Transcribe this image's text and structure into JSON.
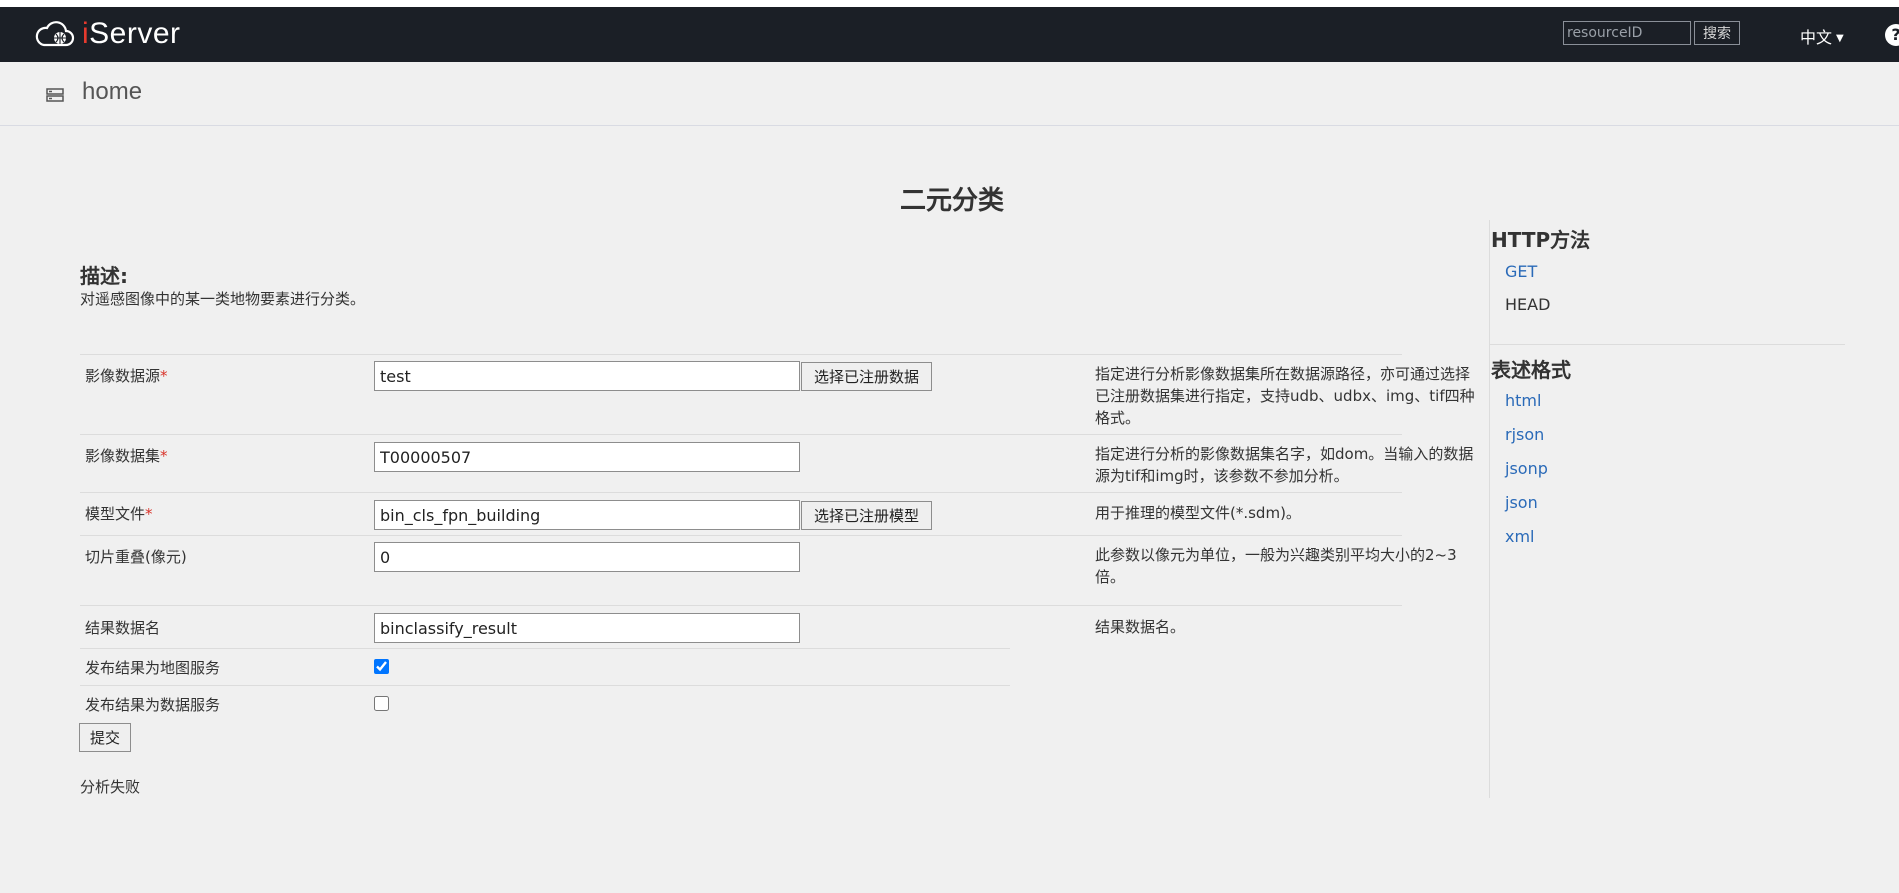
{
  "navbar": {
    "logo_prefix": "i",
    "logo_text": "Server",
    "search_placeholder": "resourceID",
    "search_button": "搜索",
    "language": "中文",
    "help": "?"
  },
  "breadcrumb": {
    "home": "home"
  },
  "page": {
    "title": "二元分类",
    "desc_heading": "描述:",
    "desc_text": "对遥感图像中的某一类地物要素进行分类。"
  },
  "form": {
    "image_datasource": {
      "label": "影像数据源",
      "required": "*",
      "value": "test",
      "button": "选择已注册数据",
      "help": "指定进行分析影像数据集所在数据源路径，亦可通过选择已注册数据集进行指定，支持udb、udbx、img、tif四种格式。"
    },
    "image_dataset": {
      "label": "影像数据集",
      "required": "*",
      "value": "T00000507",
      "help": "指定进行分析的影像数据集名字，如dom。当输入的数据源为tif和img时，该参数不参加分析。"
    },
    "model_file": {
      "label": "模型文件",
      "required": "*",
      "value": "bin_cls_fpn_building",
      "button": "选择已注册模型",
      "help": "用于推理的模型文件(*.sdm)。"
    },
    "tile_overlap": {
      "label": "切片重叠(像元)",
      "value": "0",
      "help": "此参数以像元为单位，一般为兴趣类别平均大小的2~3倍。"
    },
    "result_name": {
      "label": "结果数据名",
      "value": "binclassify_result",
      "help": "结果数据名。"
    },
    "publish_map": {
      "label": "发布结果为地图服务",
      "checked": true
    },
    "publish_data": {
      "label": "发布结果为数据服务",
      "checked": false
    },
    "submit": "提交",
    "result_message": "分析失败"
  },
  "sidebar": {
    "http_heading": "HTTP方法",
    "http_methods": [
      "GET",
      "HEAD"
    ],
    "format_heading": "表述格式",
    "formats": [
      "html",
      "rjson",
      "jsonp",
      "json",
      "xml"
    ]
  },
  "colors": {
    "navbar_bg": "#1b1f26",
    "page_bg": "#f0f0f0",
    "link": "#2a6ab8",
    "required": "#d9342b",
    "logo_accent": "#e63a2e"
  }
}
